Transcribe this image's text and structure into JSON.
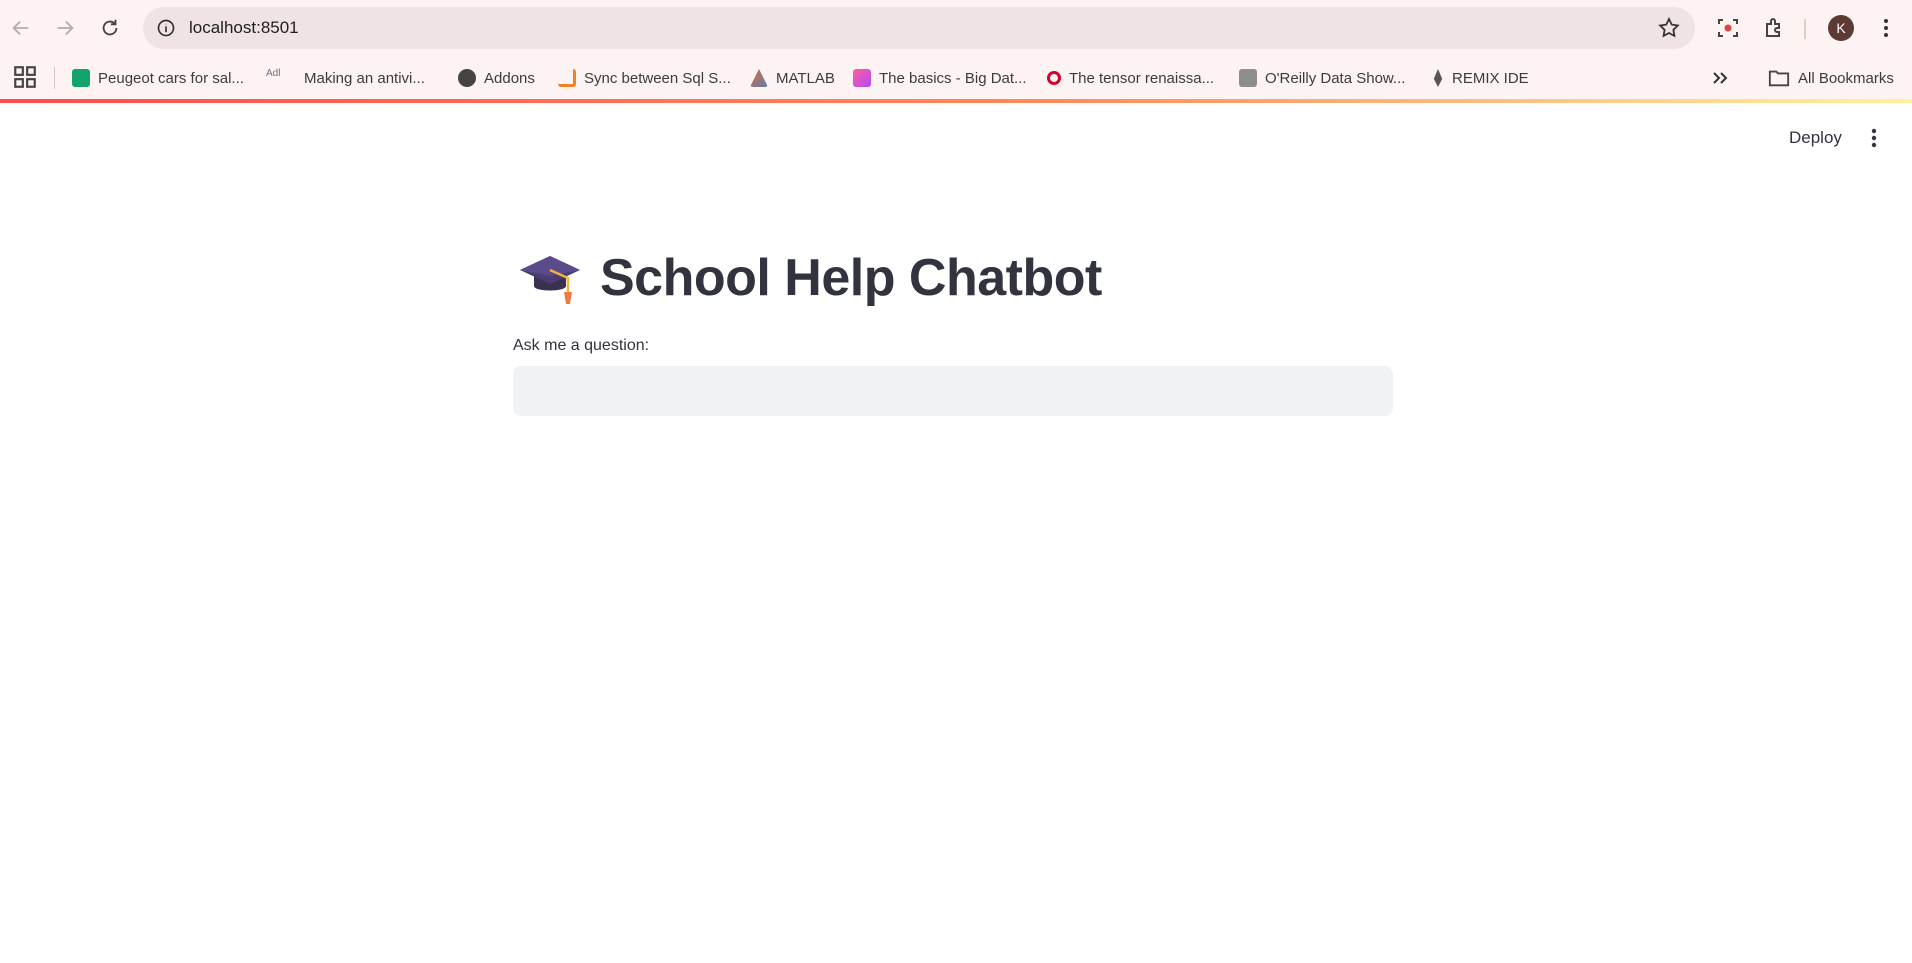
{
  "browser": {
    "url": "localhost:8501",
    "profile_initial": "K",
    "bookmarks": [
      {
        "label": "Peugeot cars for sal...",
        "icon": "face-icon",
        "color": "#13a36b"
      },
      {
        "label": "Making an antivi...",
        "icon": "adl-icon",
        "color": "#9aa0b4"
      },
      {
        "label": "Addons",
        "icon": "globe-icon",
        "color": "#444444"
      },
      {
        "label": "Sync between Sql S...",
        "icon": "stack-icon",
        "color": "#f48024"
      },
      {
        "label": "MATLAB",
        "icon": "matlab-icon",
        "color": "#e16737"
      },
      {
        "label": "The basics - Big Dat...",
        "icon": "chart-icon",
        "color": "#e34ad6"
      },
      {
        "label": "The tensor renaissa...",
        "icon": "oreilly-icon",
        "color": "#d3002d"
      },
      {
        "label": "O'Reilly Data Show...",
        "icon": "podcast-icon",
        "color": "#8e8e8e"
      },
      {
        "label": "REMIX IDE",
        "icon": "ethereum-icon",
        "color": "#555555"
      }
    ],
    "all_bookmarks_label": "All Bookmarks"
  },
  "app": {
    "deploy_label": "Deploy",
    "title": "School Help Chatbot",
    "title_icon": "graduation-cap-icon",
    "question_label": "Ask me a question:",
    "question_value": ""
  },
  "colors": {
    "accent_gradient_start": "#ff4b4b",
    "accent_gradient_end": "#fff29c",
    "text": "#31333f",
    "input_bg": "#f0f2f6"
  }
}
